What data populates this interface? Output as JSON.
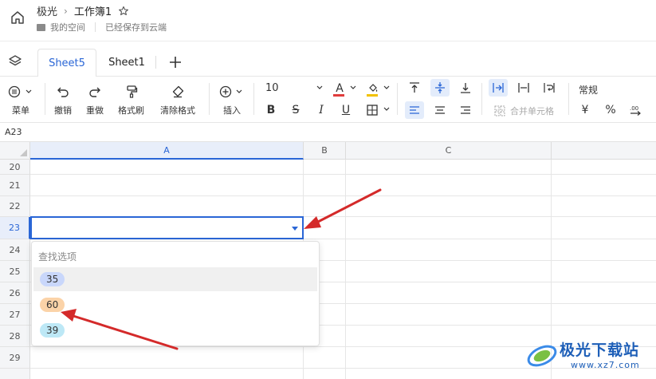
{
  "header": {
    "app_name": "极光",
    "doc_title": "工作簿1",
    "location": "我的空间",
    "save_status": "已经保存到云端"
  },
  "tabs": [
    {
      "label": "Sheet5",
      "active": true
    },
    {
      "label": "Sheet1",
      "active": false
    }
  ],
  "toolbar": {
    "menu": "菜单",
    "undo": "撤销",
    "redo": "重做",
    "format_painter": "格式刷",
    "clear_format": "清除格式",
    "insert": "插入",
    "font_size": "10",
    "merge_cells": "合并单元格",
    "number_format": "常规",
    "currency": "¥",
    "percent": "%",
    "bold": "B",
    "strike": "S",
    "italic": "I",
    "underline": "U",
    "font_color_glyph": "A"
  },
  "formula_bar": {
    "cell_ref": "A23"
  },
  "grid": {
    "columns": [
      "A",
      "B",
      "C"
    ],
    "rows": [
      "20",
      "21",
      "22",
      "23",
      "24",
      "25",
      "26",
      "27",
      "28",
      "29"
    ],
    "active_column": "A",
    "active_row": "23"
  },
  "dropdown": {
    "search_placeholder": "查找选项",
    "options": [
      {
        "label": "35",
        "color": "#c9d7fb"
      },
      {
        "label": "60",
        "color": "#fbd3a8"
      },
      {
        "label": "39",
        "color": "#bde8f6"
      }
    ]
  },
  "watermark": {
    "title": "极光下载站",
    "url": "www.xz7.com"
  },
  "colors": {
    "accent": "#2a66d6",
    "annotation_arrow": "#d42a2a"
  }
}
